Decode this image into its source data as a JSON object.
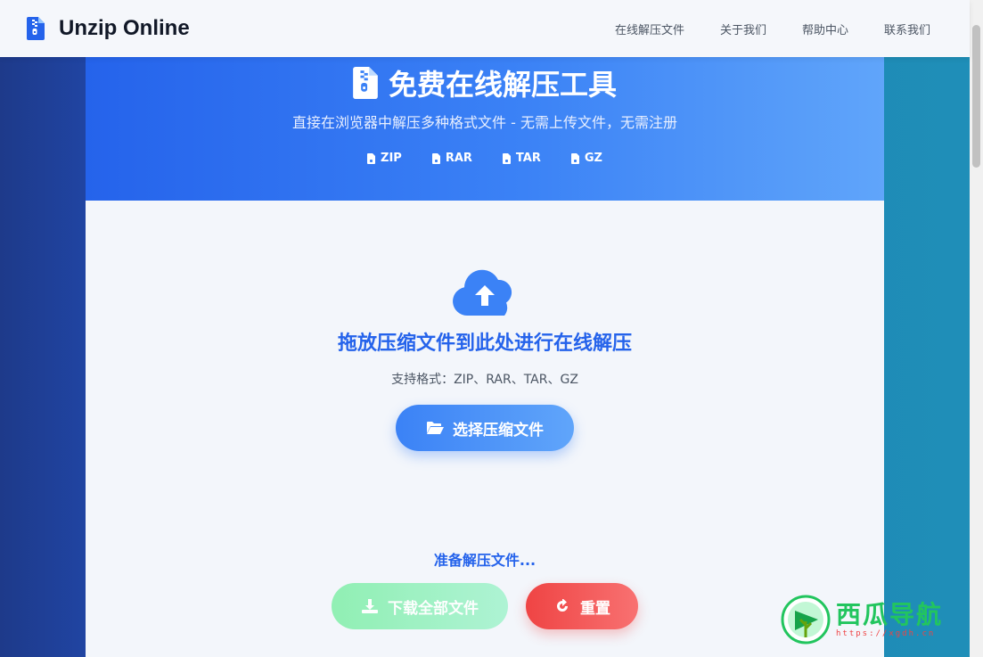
{
  "navbar": {
    "brand": "Unzip Online",
    "links": [
      "在线解压文件",
      "关于我们",
      "帮助中心",
      "联系我们"
    ]
  },
  "hero": {
    "title": "免费在线解压工具",
    "subtitle": "直接在浏览器中解压多种格式文件 - 无需上传文件，无需注册",
    "formats": [
      "ZIP",
      "RAR",
      "TAR",
      "GZ"
    ]
  },
  "upload": {
    "title": "拖放压缩文件到此处进行在线解压",
    "hint": "支持格式：ZIP、RAR、TAR、GZ",
    "select_label": "选择压缩文件"
  },
  "status": {
    "text": "准备解压文件..."
  },
  "actions": {
    "download_label": "下载全部文件",
    "reset_label": "重置"
  },
  "watermark": {
    "title": "西瓜导航",
    "url": "https://xgdh.cn"
  },
  "icons": {
    "brand": "file-zipper-icon",
    "cloud": "cloud-upload-icon",
    "folder": "folder-open-icon",
    "download": "download-icon",
    "reset": "rotate-right-icon"
  },
  "colors": {
    "primary": "#2563eb",
    "accent": "#3b82f6",
    "success": "#86efac",
    "danger": "#ef4444"
  }
}
